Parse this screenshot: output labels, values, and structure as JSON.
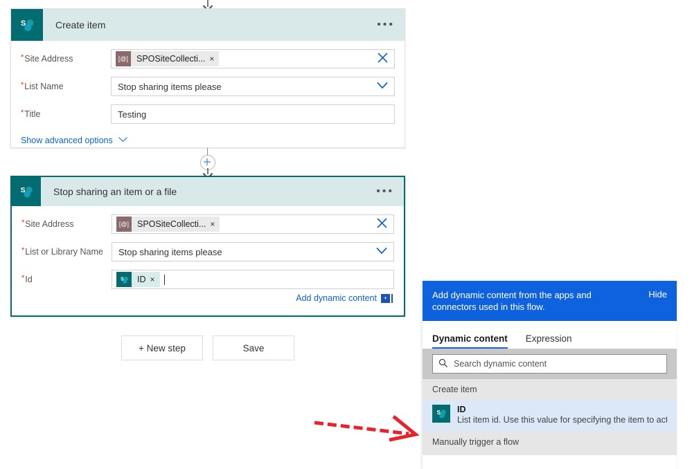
{
  "colors": {
    "sharepoint_teal": "#036c70",
    "card_header_bg": "#d9e8e8",
    "banner_blue": "#0f62dd",
    "link_blue": "#0b63ce",
    "required_red": "#d83b01",
    "annotation_red": "#e8232a",
    "selected_item_bg": "#dce8f8"
  },
  "flow": {
    "cards": [
      {
        "title": "Create item",
        "icon": "sharepoint-icon",
        "menu": "•••",
        "selected": false,
        "fields": [
          {
            "label": "Site Address",
            "required": true,
            "type": "token",
            "token_icon": "at-bracket-icon",
            "token_icon_glyph": "[@]",
            "token_label": "SPOSiteCollecti...",
            "token_remove": "×",
            "trailing_icon": "clear-icon"
          },
          {
            "label": "List Name",
            "required": true,
            "type": "dropdown",
            "value": "Stop sharing items please",
            "trailing_icon": "chevron-down-icon"
          },
          {
            "label": "Title",
            "required": true,
            "type": "text",
            "value": "Testing"
          }
        ],
        "advanced_link": "Show advanced options",
        "advanced_icon": "chevron-down-icon"
      },
      {
        "title": "Stop sharing an item or a file",
        "icon": "sharepoint-icon",
        "menu": "•••",
        "selected": true,
        "fields": [
          {
            "label": "Site Address",
            "required": true,
            "type": "token",
            "token_icon": "at-bracket-icon",
            "token_icon_glyph": "[@]",
            "token_label": "SPOSiteCollecti...",
            "token_remove": "×",
            "trailing_icon": "clear-icon"
          },
          {
            "label": "List or Library Name",
            "required": true,
            "type": "dropdown",
            "value": "Stop sharing items please",
            "trailing_icon": "chevron-down-icon"
          },
          {
            "label": "Id",
            "required": true,
            "type": "dynamic-token",
            "token_icon": "sharepoint-icon",
            "token_label": "ID",
            "token_remove": "×"
          }
        ],
        "add_dynamic_content": "Add dynamic content",
        "add_dynamic_icon": "add-dynamic-content-icon"
      }
    ],
    "insert_step_icon": "plus-circle-icon"
  },
  "actions": {
    "new_step": "+ New step",
    "save": "Save"
  },
  "dynamic_panel": {
    "banner_text": "Add dynamic content from the apps and connectors used in this flow.",
    "hide_label": "Hide",
    "tabs": [
      {
        "label": "Dynamic content",
        "active": true
      },
      {
        "label": "Expression",
        "active": false
      }
    ],
    "search": {
      "placeholder": "Search dynamic content",
      "value": "",
      "icon": "search-icon"
    },
    "groups": [
      {
        "name": "Create item",
        "items": [
          {
            "icon": "sharepoint-icon",
            "name": "ID",
            "description": "List item id. Use this value for specifying the item to act on i...",
            "selected": true
          }
        ]
      },
      {
        "name": "Manually trigger a flow",
        "items": []
      }
    ]
  },
  "annotation": {
    "type": "arrow",
    "direction": "right",
    "color": "#e8232a",
    "points_to": "ID dynamic content item"
  }
}
